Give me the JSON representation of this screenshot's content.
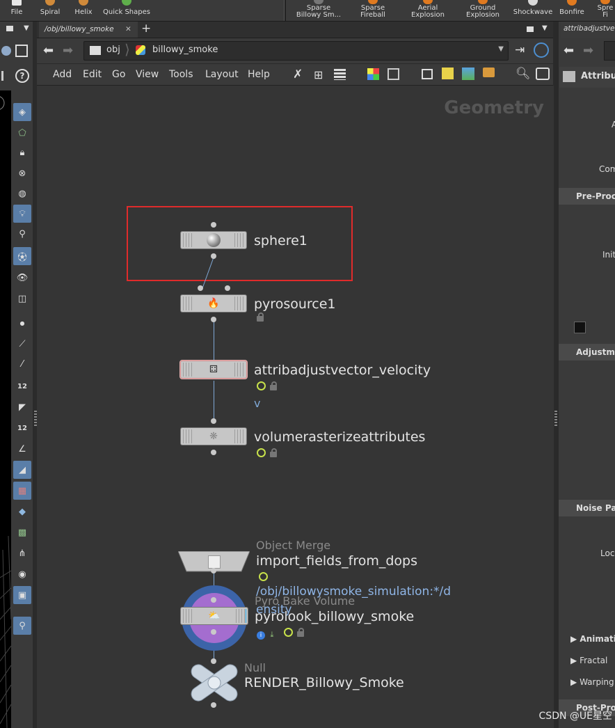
{
  "shelf": {
    "tools": [
      {
        "label": "File"
      },
      {
        "label": "Spiral"
      },
      {
        "label": "Helix"
      },
      {
        "label": "Quick Shapes"
      },
      {
        "label_line1": "Sparse",
        "label_line2": "Billowy Sm..."
      },
      {
        "label_line1": "Sparse",
        "label_line2": "Fireball"
      },
      {
        "label_line1": "Aerial",
        "label_line2": "Explosion"
      },
      {
        "label_line1": "Ground",
        "label_line2": "Explosion"
      },
      {
        "label": "Shockwave"
      },
      {
        "label": "Bonfire"
      },
      {
        "label_line1": "Spre",
        "label_line2": "Fi"
      }
    ]
  },
  "network": {
    "tab_label": "/obj/billowy_smoke",
    "path_obj": "obj",
    "path_current": "billowy_smoke",
    "menu": [
      "Add",
      "Edit",
      "Go",
      "View",
      "Tools",
      "Layout",
      "Help"
    ],
    "context_label": "Geometry",
    "nodes": {
      "sphere": {
        "name": "sphere1"
      },
      "pyrosource": {
        "name": "pyrosource1"
      },
      "attribadjust": {
        "name": "attribadjustvector_velocity",
        "info": "v"
      },
      "volumerasterize": {
        "name": "volumerasterizeattributes"
      },
      "objectmerge": {
        "type": "Object Merge",
        "name": "import_fields_from_dops",
        "info": "/obj/billowysmoke_simulation:*/d",
        "info2": "ensity"
      },
      "pyrobake": {
        "type": "Pyro Bake Volume",
        "name": "pyrolook_billowy_smoke"
      },
      "null": {
        "type": "Null",
        "name": "RENDER_Billowy_Smoke"
      }
    },
    "selection_color": "#e02b2b"
  },
  "params": {
    "tab_label": "attribadjustve",
    "header": "Attribut",
    "labels": [
      "A",
      "Com",
      "Initi",
      "Loc"
    ],
    "sections": [
      "Pre-Proce",
      "Adjustme",
      "Noise Patt",
      "Post-Proc"
    ],
    "folders": [
      "Animatio",
      "Fractal",
      "Warping"
    ]
  },
  "watermark": "CSDN @UE星空"
}
